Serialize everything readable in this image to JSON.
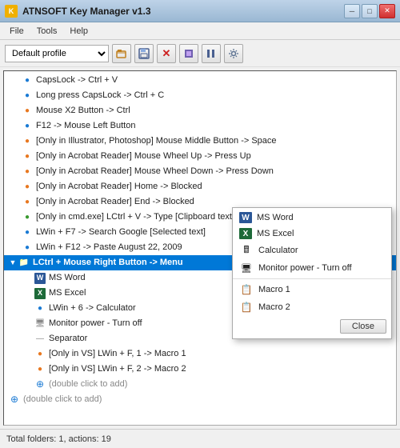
{
  "window": {
    "title": "ATNSOFT Key Manager v1.3",
    "icon": "K"
  },
  "title_buttons": [
    {
      "label": "─",
      "name": "minimize-button"
    },
    {
      "label": "□",
      "name": "maximize-button"
    },
    {
      "label": "✕",
      "name": "close-button",
      "class": "close-btn"
    }
  ],
  "menu": {
    "items": [
      {
        "label": "File",
        "name": "menu-file"
      },
      {
        "label": "Tools",
        "name": "menu-tools"
      },
      {
        "label": "Help",
        "name": "menu-help"
      }
    ]
  },
  "toolbar": {
    "profile": {
      "value": "Default profile",
      "placeholder": "Default profile"
    },
    "buttons": [
      {
        "icon": "📂",
        "name": "open-button",
        "title": "Open"
      },
      {
        "icon": "💾",
        "name": "save-button",
        "title": "Save"
      },
      {
        "icon": "✕",
        "name": "delete-button",
        "title": "Delete"
      },
      {
        "icon": "⬛",
        "name": "icon4-button",
        "title": "Option"
      },
      {
        "icon": "⏸",
        "name": "pause-button",
        "title": "Pause"
      },
      {
        "icon": "⚙",
        "name": "settings-button",
        "title": "Settings"
      }
    ]
  },
  "tree": {
    "items": [
      {
        "indent": 1,
        "icon": "🔵",
        "icon_color": "blue",
        "text": "CapsLock -> Ctrl + V",
        "expand": null
      },
      {
        "indent": 1,
        "icon": "🔵",
        "icon_color": "blue",
        "text": "Long press CapsLock -> Ctrl + C",
        "expand": null
      },
      {
        "indent": 1,
        "icon": "🟠",
        "icon_color": "orange",
        "text": "Mouse X2 Button -> Ctrl",
        "expand": null
      },
      {
        "indent": 1,
        "icon": "🔵",
        "icon_color": "blue",
        "text": "F12 -> Mouse Left Button",
        "expand": null
      },
      {
        "indent": 1,
        "icon": "🟠",
        "icon_color": "orange",
        "text": "[Only in Illustrator, Photoshop] Mouse Middle Button -> Space",
        "expand": null
      },
      {
        "indent": 1,
        "icon": "🟠",
        "icon_color": "orange",
        "text": "[Only in Acrobat Reader] Mouse Wheel Up -> Press Up",
        "expand": null
      },
      {
        "indent": 1,
        "icon": "🟠",
        "icon_color": "orange",
        "text": "[Only in Acrobat Reader] Mouse Wheel Down -> Press Down",
        "expand": null
      },
      {
        "indent": 1,
        "icon": "🟠",
        "icon_color": "orange",
        "text": "[Only in Acrobat Reader] Home -> Blocked",
        "expand": null
      },
      {
        "indent": 1,
        "icon": "🟠",
        "icon_color": "orange",
        "text": "[Only in Acrobat Reader] End -> Blocked",
        "expand": null
      },
      {
        "indent": 1,
        "icon": "🟢",
        "icon_color": "green",
        "text": "[Only in cmd.exe] LCtrl + V -> Type [Clipboard text]",
        "expand": null
      },
      {
        "indent": 1,
        "icon": "🔵",
        "icon_color": "blue",
        "text": "LWin + F7 -> Search Google [Selected text]",
        "expand": null
      },
      {
        "indent": 1,
        "icon": "🔵",
        "icon_color": "blue",
        "text": "LWin + F12 -> Paste August 22, 2009",
        "expand": null
      },
      {
        "indent": 0,
        "icon": "📁",
        "icon_color": "orange",
        "text": "LCtrl + Mouse Right Button -> Menu",
        "expand": "▼",
        "selected": true,
        "is_folder": true
      },
      {
        "indent": 1,
        "icon": "W",
        "icon_color": "blue",
        "text": "MS Word",
        "expand": null
      },
      {
        "indent": 1,
        "icon": "X",
        "icon_color": "green",
        "text": "MS Excel",
        "expand": null
      },
      {
        "indent": 1,
        "icon": "🔵",
        "icon_color": "blue",
        "text": "LWin + 6 -> Calculator",
        "expand": null
      },
      {
        "indent": 1,
        "icon": "🖥",
        "icon_color": "gray",
        "text": "Monitor power - Turn off",
        "expand": null
      },
      {
        "indent": 1,
        "icon": "—",
        "icon_color": "gray",
        "text": "Separator",
        "expand": null
      },
      {
        "indent": 1,
        "icon": "🟠",
        "icon_color": "orange",
        "text": "[Only in VS] LWin + F, 1 -> Macro 1",
        "expand": null
      },
      {
        "indent": 1,
        "icon": "🟠",
        "icon_color": "orange",
        "text": "[Only in VS] LWin + F, 2 -> Macro 2",
        "expand": null
      },
      {
        "indent": 1,
        "icon": "⊕",
        "icon_color": "blue",
        "text": "(double click to add)",
        "expand": null
      },
      {
        "indent": 0,
        "icon": "⊕",
        "icon_color": "blue",
        "text": "(double click to add)",
        "expand": null
      }
    ]
  },
  "context_menu": {
    "header": "MS Word",
    "items": [
      {
        "icon": "W",
        "icon_color": "blue",
        "label": "MS Word",
        "name": "ctx-ms-word"
      },
      {
        "icon": "X",
        "icon_color": "green",
        "label": "MS Excel",
        "name": "ctx-ms-excel"
      },
      {
        "icon": "🖩",
        "icon_color": "gray",
        "label": "Calculator",
        "name": "ctx-calculator"
      },
      {
        "icon": "🖥",
        "icon_color": "gray",
        "label": "Monitor power - Turn off",
        "name": "ctx-monitor-power"
      },
      {
        "separator": true
      },
      {
        "icon": "📋",
        "icon_color": "orange",
        "label": "Macro 1",
        "name": "ctx-macro1"
      },
      {
        "icon": "📋",
        "icon_color": "orange",
        "label": "Macro 2",
        "name": "ctx-macro2"
      }
    ],
    "close_label": "Close"
  },
  "status_bar": {
    "text": "Total folders: 1, actions: 19"
  }
}
